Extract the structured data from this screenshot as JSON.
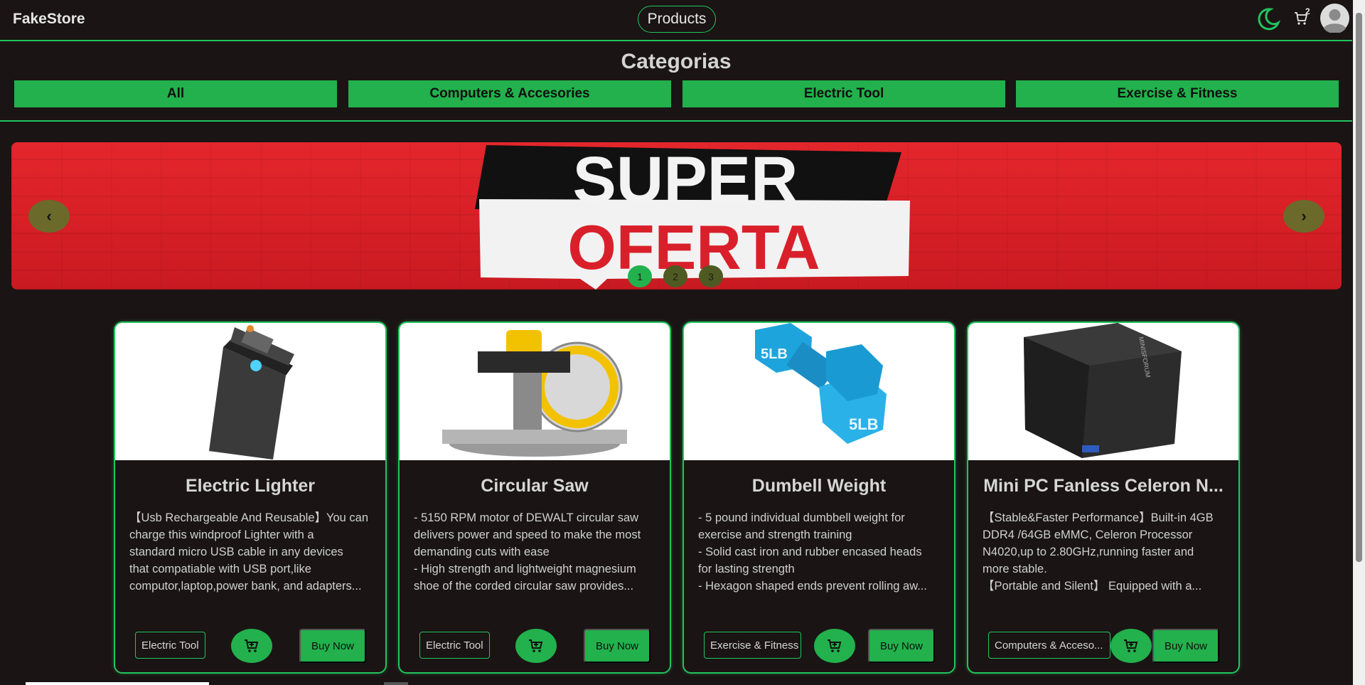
{
  "navbar": {
    "brand": "FakeStore",
    "products_label": "Products",
    "cart_count": "2",
    "accent_color": "#22c55e"
  },
  "categories": {
    "title": "Categorias",
    "items": [
      "All",
      "Computers & Accesories",
      "Electric Tool",
      "Exercise & Fitness"
    ]
  },
  "banner": {
    "line1": "SUPER",
    "line2": "OFERTA",
    "dots": [
      "1",
      "2",
      "3"
    ],
    "active_dot": "1",
    "prev_icon": "‹",
    "next_icon": "›"
  },
  "products": [
    {
      "title": "Electric Lighter",
      "description": [
        "【Usb Rechargeable And Reusable】You can",
        "charge this windproof Lighter with a",
        "standard micro USB cable in any devices",
        "that compatiable with USB port,like",
        "computor,laptop,power bank, and adapters..."
      ],
      "category": "Electric Tool",
      "buy_label": "Buy Now",
      "image_icon": "lighter-icon"
    },
    {
      "title": "Circular Saw",
      "description": [
        "- 5150 RPM motor of DEWALT circular saw",
        "delivers power and speed to make the most",
        "demanding cuts with ease",
        "- High strength and lightweight magnesium",
        "shoe of the corded circular saw provides..."
      ],
      "category": "Electric Tool",
      "buy_label": "Buy Now",
      "image_icon": "saw-icon"
    },
    {
      "title": "Dumbell Weight",
      "description": [
        "- 5 pound individual dumbbell weight for",
        "exercise and strength training",
        "- Solid cast iron and rubber encased heads",
        "for lasting strength",
        "- Hexagon shaped ends prevent rolling aw..."
      ],
      "category": "Exercise & Fitness",
      "buy_label": "Buy Now",
      "image_icon": "dumbbell-icon",
      "weight_label": "5LB"
    },
    {
      "title": "Mini PC Fanless Celeron N...",
      "description": [
        "【Stable&Faster Performance】Built-in 4GB",
        "DDR4 /64GB eMMC, Celeron Processor",
        "N4020,up to 2.80GHz,running faster and",
        "more stable.",
        "【Portable and Silent】 Equipped with a..."
      ],
      "category": "Computers & Acceso...",
      "buy_label": "Buy Now",
      "image_icon": "mini-pc-icon",
      "brand_mark": "MINISFORUM"
    }
  ]
}
